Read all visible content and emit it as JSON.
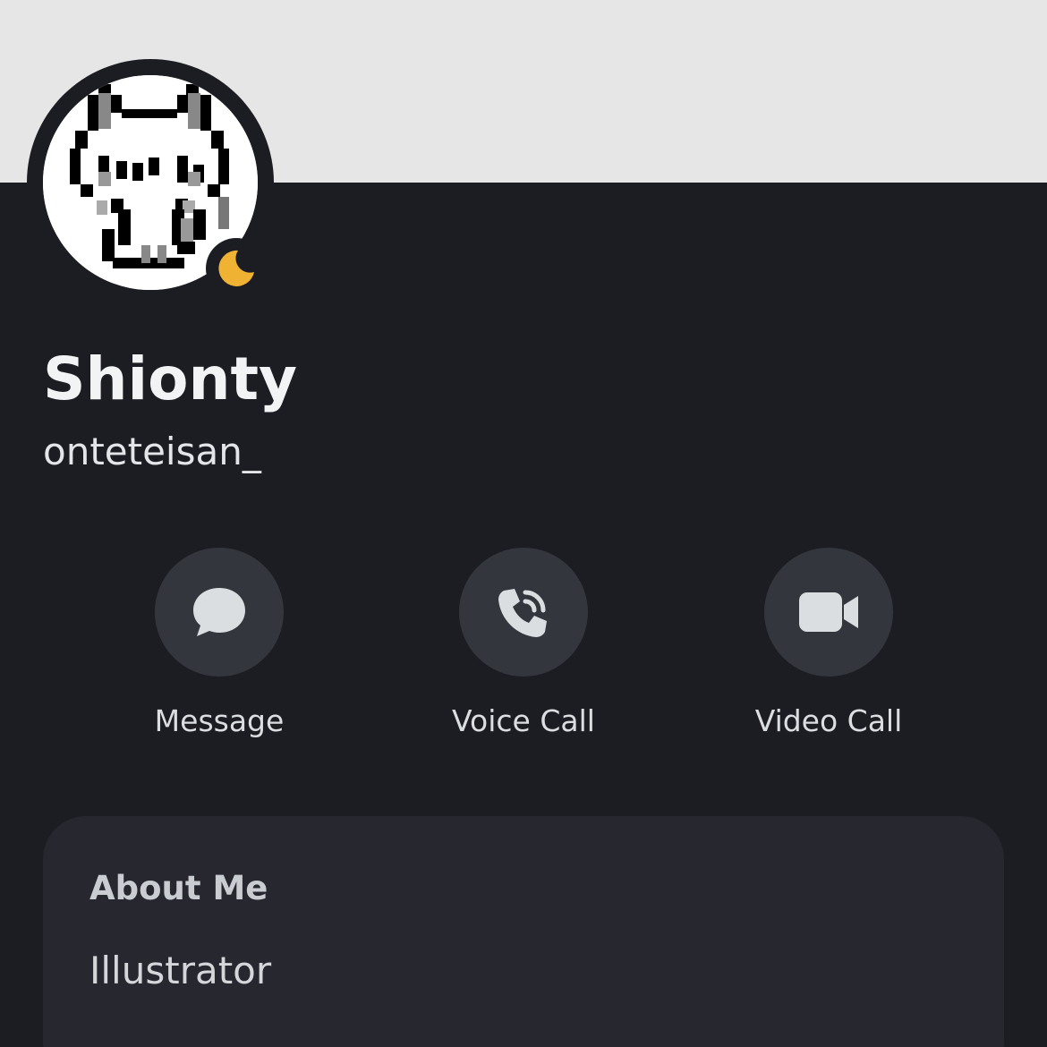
{
  "profile": {
    "display_name": "Shionty",
    "username": "onteteisan_",
    "status": "idle",
    "status_color": "#f0b232",
    "avatar": "pixel-cat-avatar"
  },
  "actions": [
    {
      "label": "Message",
      "icon": "chat-bubble-icon"
    },
    {
      "label": "Voice Call",
      "icon": "phone-icon"
    },
    {
      "label": "Video Call",
      "icon": "video-camera-icon"
    }
  ],
  "about": {
    "title": "About Me",
    "text": "Illustrator"
  },
  "colors": {
    "background": "#1c1d22",
    "banner": "#e6e6e6",
    "button": "#34363d",
    "card": "#26272f",
    "icon": "#dbdee1"
  }
}
